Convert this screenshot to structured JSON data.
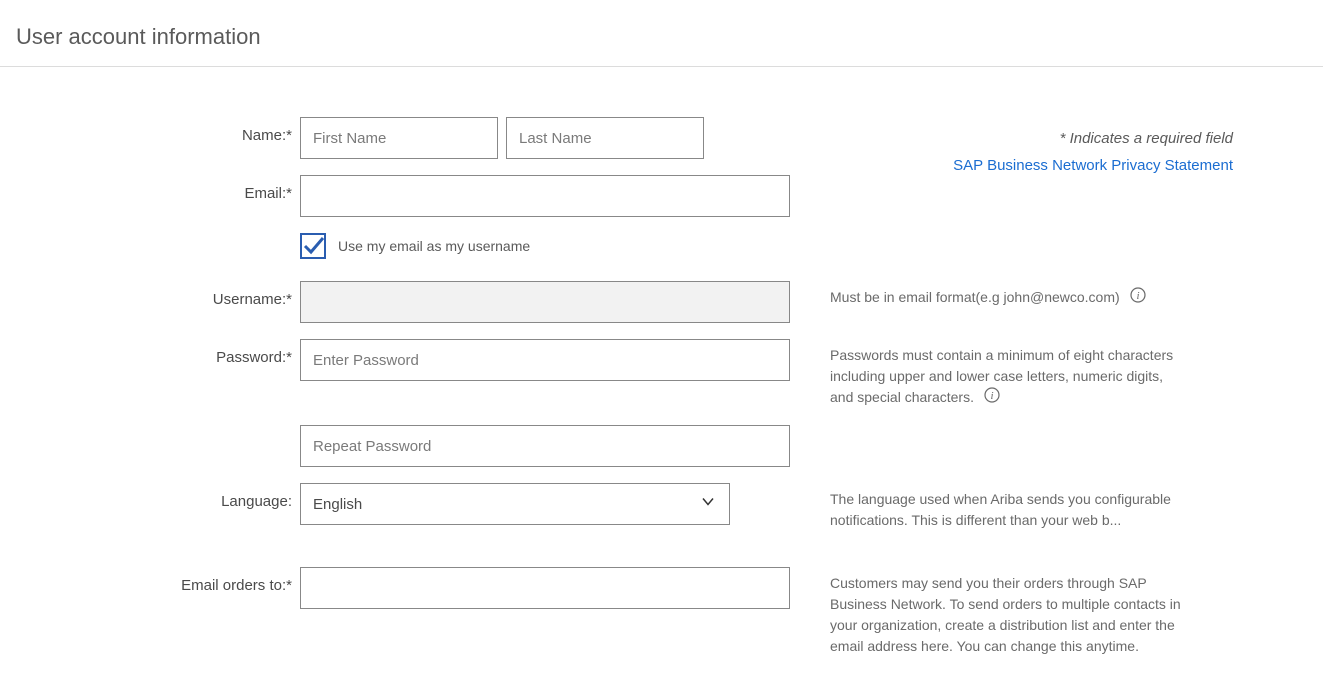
{
  "page": {
    "title": "User account information",
    "required_hint": "*  Indicates a required field",
    "privacy_link": "SAP Business Network Privacy Statement"
  },
  "fields": {
    "name": {
      "label": "Name:",
      "first_placeholder": "First Name",
      "last_placeholder": "Last Name"
    },
    "email": {
      "label": "Email:",
      "value": ""
    },
    "use_email_checkbox": {
      "label": "Use my email as my username",
      "checked": true
    },
    "username": {
      "label": "Username:",
      "value": "",
      "hint": "Must be in email format(e.g john@newco.com)"
    },
    "password": {
      "label": "Password:",
      "placeholder": "Enter Password",
      "repeat_placeholder": "Repeat Password",
      "hint": "Passwords must contain a minimum of eight characters including upper and lower case letters, numeric digits, and special characters."
    },
    "language": {
      "label": "Language:",
      "value": "English",
      "hint": "The language used when Ariba sends you configurable notifications. This is different than your web b..."
    },
    "email_orders": {
      "label": "Email orders to:",
      "value": "",
      "hint": "Customers may send you their orders through SAP Business Network. To send orders to multiple contacts in your organization, create a distribution list and enter the email address here. You can change this anytime."
    }
  },
  "symbols": {
    "asterisk": "*"
  }
}
